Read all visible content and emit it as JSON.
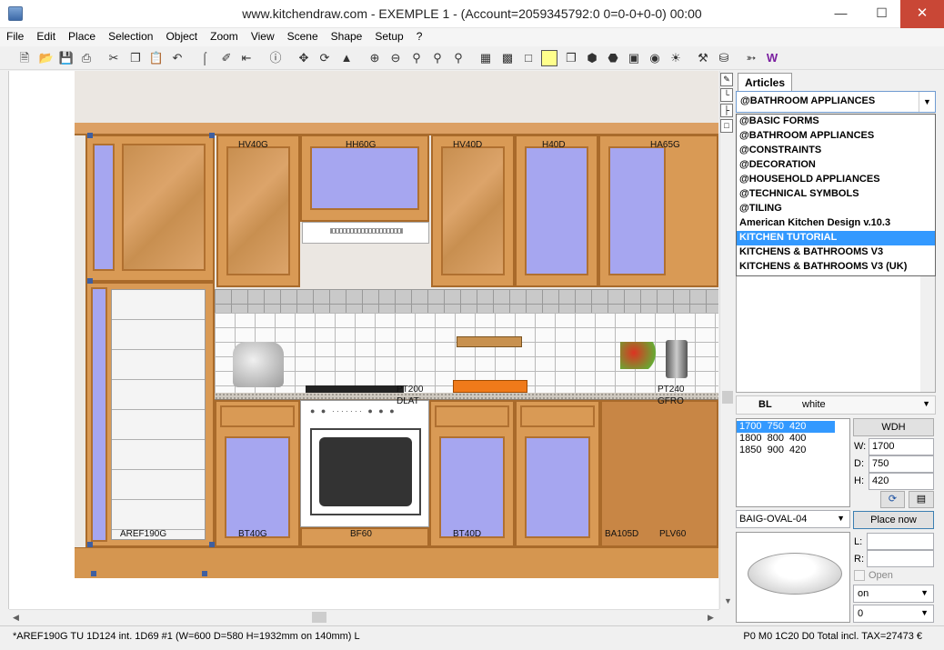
{
  "window": {
    "title": "www.kitchendraw.com - EXEMPLE 1 - (Account=2059345792:0 0=0-0+0-0) 00:00"
  },
  "menu": [
    "File",
    "Edit",
    "Place",
    "Selection",
    "Object",
    "Zoom",
    "View",
    "Scene",
    "Shape",
    "Setup",
    "?"
  ],
  "toolbar_icons": [
    "new-file-icon",
    "open-folder-icon",
    "save-icon",
    "print-icon",
    "cut-icon",
    "copy-icon",
    "paste-icon",
    "undo-icon",
    "stairs-tool-icon",
    "brush-tool-icon",
    "dimension-icon",
    "info-icon",
    "move-icon",
    "rotate-icon",
    "align-icon",
    "zoom-in-icon",
    "zoom-out-icon",
    "zoom-window-icon",
    "zoom-previous-icon",
    "zoom-all-icon",
    "plan-view-icon",
    "elevation-view-icon",
    "wireframe-icon",
    "flat-shade-icon",
    "perspective-icon",
    "cube-icon",
    "solid-icon",
    "camera-icon",
    "photo-icon",
    "light-icon",
    "tools-icon",
    "lock-icon",
    "export-icon",
    "web-icon"
  ],
  "drawing": {
    "labels": {
      "hv40g": "HV40G",
      "hh60g": "HH60G",
      "hv40d": "HV40D",
      "h40d": "H40D",
      "ha65g": "HA65G",
      "pt200": "PT200",
      "dlat": "DLAT",
      "pt240": "PT240",
      "gfro": "GFRO",
      "aref190g": "AREF190G",
      "bt40g": "BT40G",
      "bf60": "BF60",
      "bt40d": "BT40D",
      "ba105d": "BA105D",
      "plv60": "PLV60"
    }
  },
  "panel": {
    "tab_label": "Articles",
    "category_selected": "@BATHROOM APPLIANCES",
    "categories": [
      "@BASIC FORMS",
      "@BATHROOM APPLIANCES",
      "@CONSTRAINTS",
      "@DECORATION",
      "@HOUSEHOLD APPLIANCES",
      "@TECHNICAL SYMBOLS",
      "@TILING",
      "American Kitchen Design v.10.3",
      "KITCHEN TUTORIAL",
      "KITCHENS & BATHROOMS V3",
      "KITCHENS & BATHROOMS V3 (UK)"
    ],
    "highlighted_category": "KITCHEN TUTORIAL",
    "finish_code": "BL",
    "finish_name": "white",
    "dimensions": [
      "1700  750  420",
      "1800  800  400",
      "1850  900  420"
    ],
    "wdh_button": "WDH",
    "w_label": "W:",
    "w_value": "1700",
    "d_label": "D:",
    "d_value": "750",
    "h_label": "H:",
    "h_value": "420",
    "model": "BAIG-OVAL-04",
    "place_now": "Place now",
    "l_label": "L:",
    "r_label": "R:",
    "open_label": "Open",
    "on_value": "on",
    "zero_value": "0"
  },
  "status": {
    "left": "*AREF190G  TU 1D124 int. 1D69 #1  (W=600 D=580 H=1932mm on 140mm) L",
    "right": "P0 M0 1C20 D0 Total incl. TAX=27473 €"
  }
}
